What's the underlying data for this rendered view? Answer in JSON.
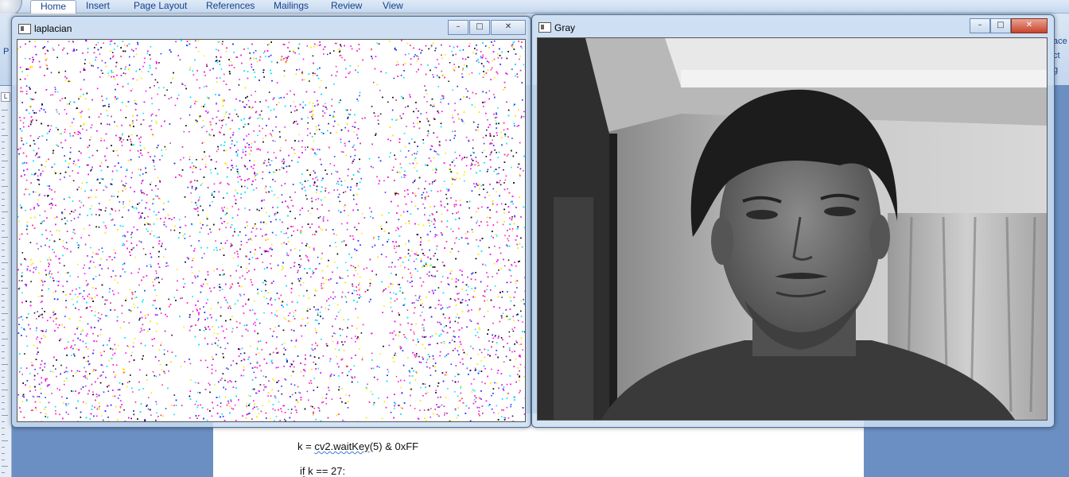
{
  "word": {
    "tabs": [
      "Home",
      "Insert",
      "Page Layout",
      "References",
      "Mailings",
      "Review",
      "View"
    ],
    "active_tab": "Home",
    "right_fragments": [
      "ace",
      "ct",
      "g"
    ],
    "left_fragment": "P",
    "ruler_marker": "L",
    "code": {
      "line1_pre": "k = ",
      "line1_func": "cv2.waitKey",
      "line1_post": "(5) & 0xFF",
      "line2_kw": "if",
      "line2_rest": " k == 27:"
    }
  },
  "windows": {
    "laplacian": {
      "title": "laplacian",
      "controls": {
        "minimize": "–",
        "maximize": "□",
        "close": "✕"
      }
    },
    "gray": {
      "title": "Gray",
      "controls": {
        "minimize": "–",
        "maximize": "□",
        "close": "✕"
      }
    }
  },
  "colors": {
    "noise": [
      "#ff00ff",
      "#cc33cc",
      "#00e5ff",
      "#ffe600",
      "#2233ff",
      "#ff3399",
      "#111111"
    ],
    "accent": "#15428b"
  }
}
